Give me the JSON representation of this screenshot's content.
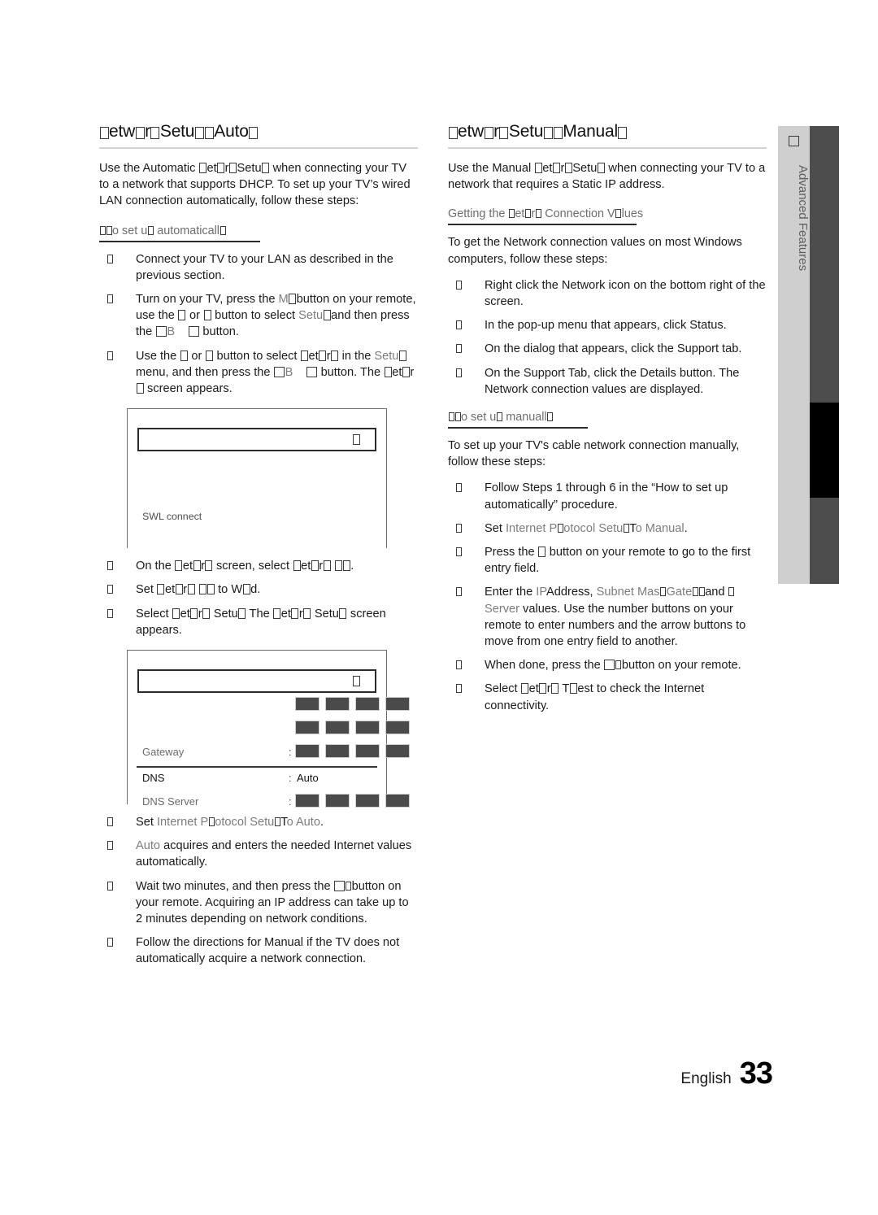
{
  "page": {
    "footer_language": "English",
    "footer_page_number": "33"
  },
  "side_tab": {
    "label": "Advanced Features",
    "glyph_name": "missing-glyph-box"
  },
  "left_column": {
    "title_parts": [
      "Netw",
      "ork Setup ",
      "Auto"
    ],
    "title_plain": "Network Setup (Auto)",
    "intro": "Use the Automatic Network Setup when connecting your TV to a network that supports DHCP. To set up your TV's wired LAN connection automatically, follow these steps:",
    "subhead": "How to set up automatically",
    "steps": [
      {
        "text_1": "Connect your TV to your LAN as described in the previous section."
      },
      {
        "text_1": "Turn on your TV, press the ",
        "menu": "MENU",
        "text_2": " button on your remote, use the ",
        "text_3": " or ",
        "text_4": " button to select ",
        "setup": "Setup",
        "text_5": " and then press the ",
        "enter": "ENTER",
        "text_6": " button."
      },
      {
        "text_1": "Use the ",
        "text_2": " or ",
        "text_3": " button to select ",
        "network": "Network",
        "text_4": " in the ",
        "setup": "Setup",
        "text_5": " menu, and then press the ",
        "enter": "ENTER",
        "text_6": " button. The ",
        "network2": "Network",
        "text_7": " screen appears."
      }
    ],
    "screenshot_1": {
      "name": "network-screen",
      "field_caret": "caret",
      "swl_label": "SWL connect"
    },
    "steps_2": [
      {
        "text_1": "On the ",
        "network": "Network",
        "text_2": " screen, select ",
        "network_type": "Network Type",
        "text_3": "."
      },
      {
        "text_1": "Set ",
        "network_type": "Network Type",
        "text_2": " to ",
        "wired": "Wired",
        "text_3": "."
      },
      {
        "text_1": "Select ",
        "network_setup": "Network Setup",
        "text_2": ". The ",
        "network_setup2": "Network Setup",
        "text_3": " screen appears."
      }
    ],
    "screenshot_2": {
      "name": "network-setup-screen",
      "field_caret": "caret",
      "rows": [
        {
          "label": "",
          "colon": "",
          "value_type": "octets"
        },
        {
          "label": "",
          "colon": "",
          "value_type": "octets"
        },
        {
          "label": "Gateway",
          "colon": ":",
          "value_type": "octets"
        },
        {
          "label": "DNS",
          "colon": ":",
          "value_type": "text",
          "value": "Auto",
          "selected": true
        },
        {
          "label": "DNS Server",
          "colon": ":",
          "value_type": "octets"
        }
      ]
    },
    "steps_3": [
      {
        "text_1": "Set ",
        "ips": "Internet Protocol Setup",
        "text_2": " to ",
        "auto": "Auto",
        "text_3": "."
      },
      {
        "auto": "Auto",
        "text_1": " acquires and enters the needed Internet values automatically."
      },
      {
        "text_1": "Wait two minutes, and then press the ",
        "enter": "ENTER",
        "text_2": " button on your remote. Acquiring an IP address can take  up to 2 minutes depending on network conditions."
      },
      {
        "text_1": "Follow the directions for Manual if the TV does not automatically acquire a network connection."
      }
    ]
  },
  "right_column": {
    "title_plain": "Network Setup (Manual)",
    "intro": "Use the Manual Network Setup when connecting your TV to a network that requires a Static IP address.",
    "subhead_1": "Getting the Network Connection Values",
    "intro_2": "To get the Network connection values on most Windows computers, follow these steps:",
    "steps_1": [
      {
        "text_1": "Right click the Network icon on the bottom right of the screen."
      },
      {
        "text_1": "In the pop-up menu that appears, click Status."
      },
      {
        "text_1": "On the dialog that appears, click the Support tab."
      },
      {
        "text_1": "On the Support Tab, click the Details button. The Network connection values are displayed."
      }
    ],
    "subhead_2": "How to set up manually",
    "intro_3": "To set up your TV's cable network connection manually, follow these steps:",
    "steps_2": [
      {
        "text_1": "Follow Steps 1 through 6 in the “How to set up automatically” procedure."
      },
      {
        "text_1": "Set ",
        "ips": "Internet Protocol Setup",
        "text_2": " to ",
        "manual": "Manual",
        "text_3": "."
      },
      {
        "text_1": "Press the ",
        "text_2": " button on your remote to go to the first entry field."
      },
      {
        "text_1": "Enter the ",
        "ip_address": "IP Address",
        "text_2": ", ",
        "subnet": "Subnet Mask",
        "text_3": ", ",
        "gateway": "Gateway",
        "text_4": " and ",
        "dns": "DNS Server",
        "text_5": " values. Use the number buttons on your remote to enter numbers and the arrow buttons to move from one entry field to another."
      },
      {
        "text_1": "When done, press the ",
        "enter": "ENTER",
        "text_2": " button on your remote."
      },
      {
        "text_1": "Select ",
        "network_test": "Network Test",
        "text_2": " to check the Internet connectivity."
      }
    ]
  }
}
